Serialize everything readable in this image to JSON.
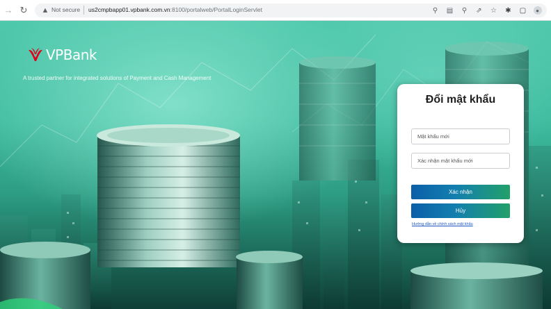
{
  "browser": {
    "security_label": "Not secure",
    "url_host": "us2cmpbapp01.vpbank.com.vn",
    "url_path": ":8100/portalweb/PortalLoginServlet",
    "icons": [
      "back-icon",
      "reload-icon",
      "info-icon",
      "key-icon",
      "translate-icon",
      "zoom-icon",
      "share-icon",
      "star-icon",
      "extensions-icon",
      "sidebar-icon",
      "profile-icon"
    ]
  },
  "brand": {
    "name": "VPBank",
    "tagline": "A trusted partner for integrated solutions of Payment and Cash Management",
    "logo_color": "#e3001b"
  },
  "card": {
    "title": "Đổi mật khẩu",
    "new_password_placeholder": "Mật khẩu mới",
    "confirm_password_placeholder": "Xác nhận mật khẩu mới",
    "confirm_button": "Xác nhận",
    "cancel_button": "Hủy",
    "help_link": "Hướng dẫn về chính sách mật khẩu"
  },
  "colors": {
    "hero_green": "#3ebb9e",
    "button_blue": "#0b5fa8",
    "button_green": "#22a06a",
    "link": "#1a56c4"
  }
}
